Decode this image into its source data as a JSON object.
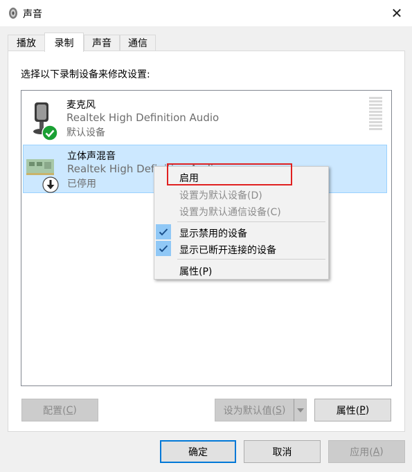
{
  "window": {
    "title": "声音",
    "close_glyph": "✕"
  },
  "tabs": [
    {
      "label": "播放",
      "active": false
    },
    {
      "label": "录制",
      "active": true
    },
    {
      "label": "声音",
      "active": false
    },
    {
      "label": "通信",
      "active": false
    }
  ],
  "instruction": "选择以下录制设备来修改设置:",
  "devices": [
    {
      "name": "麦克风",
      "driver": "Realtek High Definition Audio",
      "status": "默认设备",
      "icon": "microphone-icon",
      "badge": "default-check-icon"
    },
    {
      "name": "立体声混音",
      "driver": "Realtek High Definition Audio",
      "status": "已停用",
      "icon": "sound-card-icon",
      "badge": "disabled-down-arrow-icon",
      "selected": true
    }
  ],
  "context_menu": {
    "enable": "启用",
    "set_default": "设置为默认设备(D)",
    "set_default_comm": "设置为默认通信设备(C)",
    "show_disabled": "显示禁用的设备",
    "show_disconnected": "显示已断开连接的设备",
    "properties": "属性(P)"
  },
  "buttons": {
    "configure_pre": "配置(",
    "configure_key": "C",
    "configure_post": ")",
    "set_default_pre": "设为默认值(",
    "set_default_key": "S",
    "set_default_post": ")",
    "properties_pre": "属性(",
    "properties_key": "P",
    "properties_post": ")",
    "ok": "确定",
    "cancel": "取消",
    "apply_pre": "应用(",
    "apply_key": "A",
    "apply_post": ")"
  },
  "colors": {
    "selection": "#cce8ff",
    "check_green": "#1aa034",
    "highlight_box": "#e02020",
    "default_button_border": "#0078d7"
  }
}
